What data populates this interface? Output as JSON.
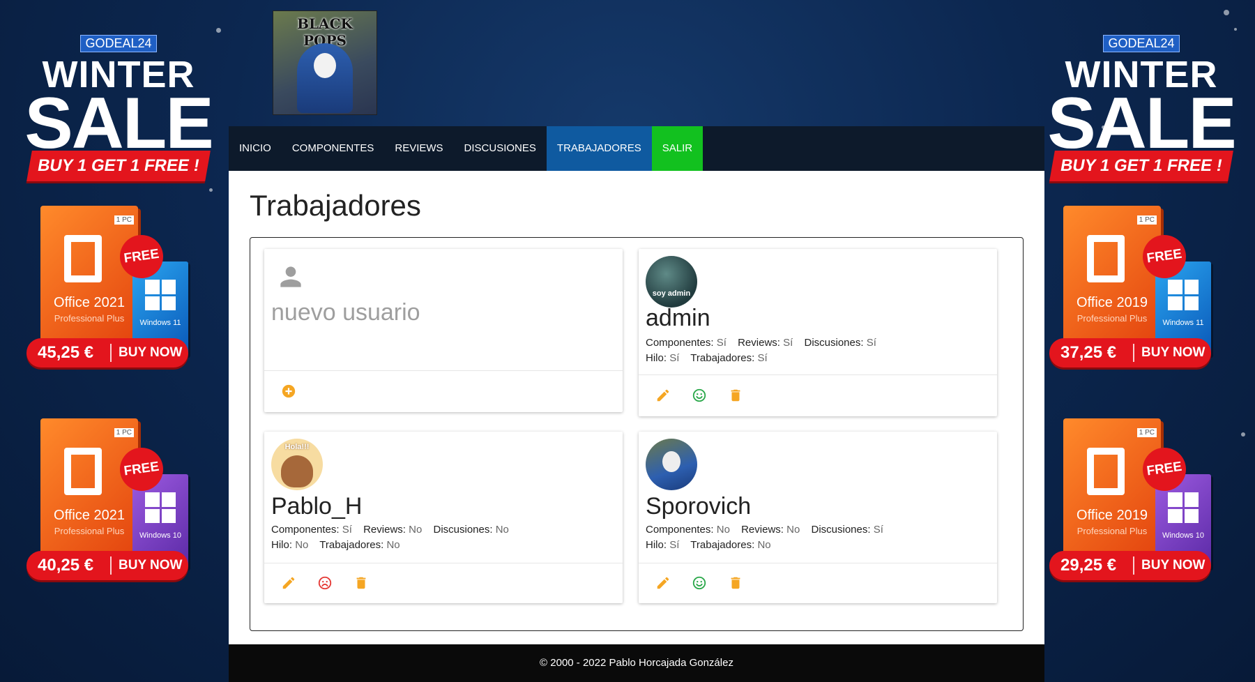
{
  "ads": {
    "brand": "GODEAL24",
    "headline_1": "WINTER",
    "headline_2": "SALE",
    "promo": "BUY 1 GET 1 FREE !",
    "free_badge": "FREE",
    "buy_label": "BUY NOW",
    "pc_tag": "1 PC",
    "left": [
      {
        "office": "Office 2021",
        "edition": "Professional Plus",
        "windows": "Windows 11",
        "price": "45,25 €"
      },
      {
        "office": "Office 2021",
        "edition": "Professional Plus",
        "windows": "Windows 10",
        "price": "40,25 €"
      }
    ],
    "right": [
      {
        "office": "Office 2019",
        "edition": "Professional Plus",
        "windows": "Windows 11",
        "price": "37,25 €"
      },
      {
        "office": "Office 2019",
        "edition": "Professional Plus",
        "windows": "Windows 10",
        "price": "29,25 €"
      }
    ]
  },
  "site": {
    "logo_text": "BLACK POPS",
    "nav": [
      "INICIO",
      "COMPONENTES",
      "REVIEWS",
      "DISCUSIONES",
      "TRABAJADORES",
      "SALIR"
    ],
    "page_title": "Trabajadores",
    "new_user_label": "nuevo usuario",
    "footer": "© 2000 - 2022 Pablo Horcajada González"
  },
  "users": [
    {
      "name": "admin",
      "avatar_caption": "soy admin",
      "componentes": "Sí",
      "reviews": "Sí",
      "discusiones": "Sí",
      "hilo": "Sí",
      "trabajadores": "Sí",
      "status_icon": "smile-icon",
      "status_color": "#2aa84a"
    },
    {
      "name": "Pablo_H",
      "avatar_caption": "Hola!!!",
      "componentes": "Sí",
      "reviews": "No",
      "discusiones": "No",
      "hilo": "No",
      "trabajadores": "No",
      "status_icon": "frown-icon",
      "status_color": "#e53935"
    },
    {
      "name": "Sporovich",
      "avatar_caption": "",
      "componentes": "No",
      "reviews": "No",
      "discusiones": "Sí",
      "hilo": "Sí",
      "trabajadores": "No",
      "status_icon": "smile-icon",
      "status_color": "#2aa84a"
    }
  ],
  "labels": {
    "componentes": "Componentes:",
    "reviews": "Reviews:",
    "discusiones": "Discusiones:",
    "hilo": "Hilo:",
    "trabajadores": "Trabajadores:"
  },
  "colors": {
    "nav_active": "#0f5aa0",
    "nav_exit": "#12c11f",
    "action_orange": "#f5a623",
    "navbar_bg": "#0d1a2b"
  }
}
